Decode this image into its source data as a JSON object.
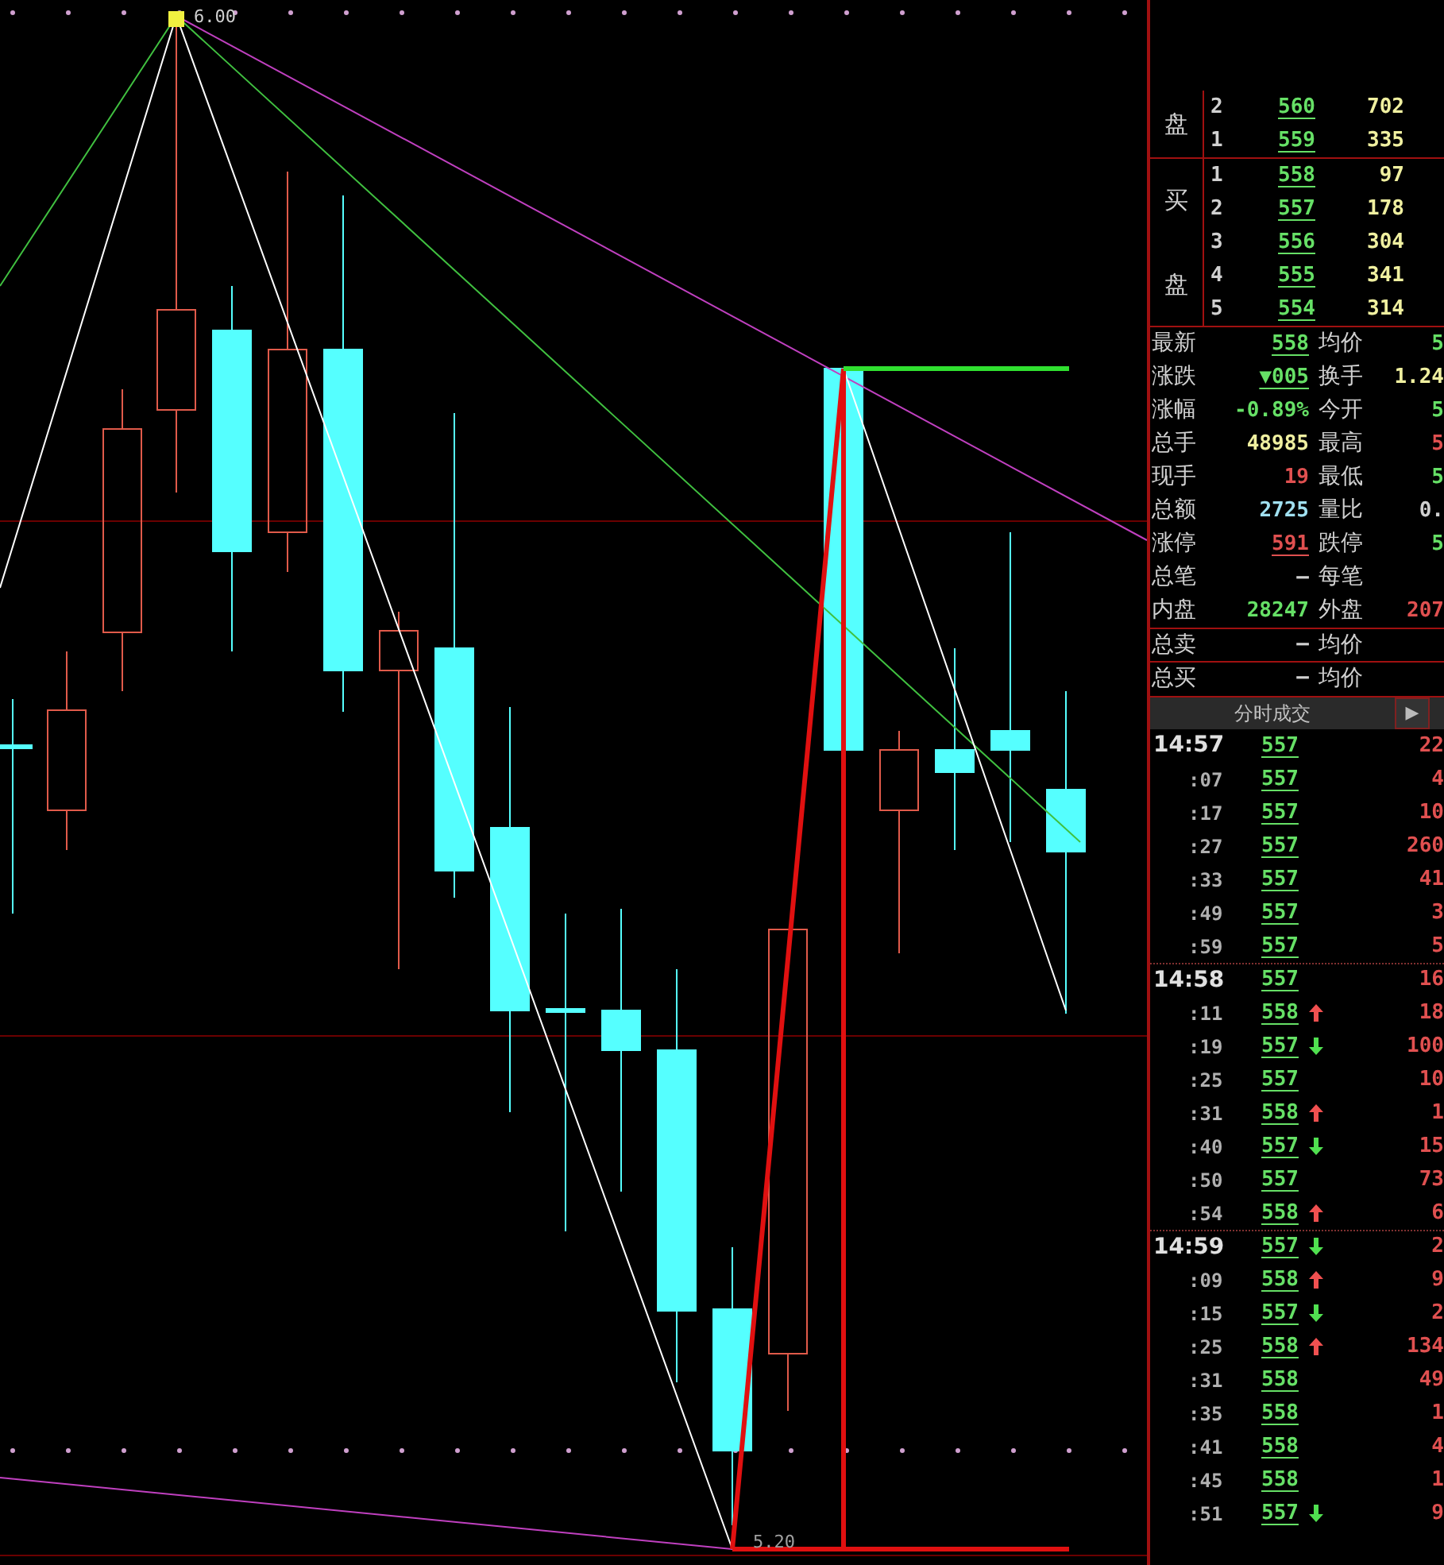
{
  "chart": {
    "high_label": "6.00",
    "low_label": "5.20"
  },
  "order_book": {
    "sell": {
      "labels": [
        "盘"
      ],
      "levels": [
        {
          "level": "2",
          "price": "560",
          "volume": "702"
        },
        {
          "level": "1",
          "price": "559",
          "volume": "335"
        }
      ]
    },
    "buy": {
      "labels": [
        "买",
        "盘"
      ],
      "levels": [
        {
          "level": "1",
          "price": "558",
          "volume": "97"
        },
        {
          "level": "2",
          "price": "557",
          "volume": "178"
        },
        {
          "level": "3",
          "price": "556",
          "volume": "304"
        },
        {
          "level": "4",
          "price": "555",
          "volume": "341"
        },
        {
          "level": "5",
          "price": "554",
          "volume": "314"
        }
      ]
    }
  },
  "stats": [
    {
      "cells": [
        {
          "label": "最新",
          "value": "558",
          "color": "#66e066",
          "underlined": true
        },
        {
          "label": "均价",
          "value": "5",
          "color": "#66e066",
          "underlined": false
        }
      ]
    },
    {
      "cells": [
        {
          "label": "涨跌",
          "value": "▼005",
          "color": "#66e066",
          "underlined": true
        },
        {
          "label": "换手",
          "value": "1.24",
          "color": "#f0f0a0",
          "underlined": false
        }
      ]
    },
    {
      "cells": [
        {
          "label": "涨幅",
          "value": "-0.89%",
          "color": "#66e066",
          "underlined": false
        },
        {
          "label": "今开",
          "value": "5",
          "color": "#66e066",
          "underlined": false
        }
      ]
    },
    {
      "cells": [
        {
          "label": "总手",
          "value": "48985",
          "color": "#f0f0a0",
          "underlined": false
        },
        {
          "label": "最高",
          "value": "5",
          "color": "#e05050",
          "underlined": false
        }
      ]
    },
    {
      "cells": [
        {
          "label": "现手",
          "value": "19",
          "color": "#e05050",
          "underlined": false
        },
        {
          "label": "最低",
          "value": "5",
          "color": "#66e066",
          "underlined": false
        }
      ]
    },
    {
      "cells": [
        {
          "label": "总额",
          "value": "2725",
          "color": "#a0e0f0",
          "underlined": false
        },
        {
          "label": "量比",
          "value": "0.",
          "color": "#d0d0d0",
          "underlined": false
        }
      ]
    },
    {
      "cells": [
        {
          "label": "涨停",
          "value": "591",
          "color": "#e05050",
          "underlined": true
        },
        {
          "label": "跌停",
          "value": "5",
          "color": "#66e066",
          "underlined": false
        }
      ]
    },
    {
      "cells": [
        {
          "label": "总笔",
          "value": "–",
          "color": "#d0d0d0",
          "underlined": false
        },
        {
          "label": "每笔"
        }
      ]
    },
    {
      "cells": [
        {
          "label": "内盘",
          "value": "28247",
          "color": "#66e066",
          "underlined": false
        },
        {
          "label": "外盘",
          "value": "207",
          "color": "#e05050",
          "underlined": false
        }
      ]
    }
  ],
  "totals": [
    {
      "label": "总卖",
      "value": "–",
      "label_2": "均价"
    },
    {
      "label": "总买",
      "value": "–",
      "label_2": "均价"
    }
  ],
  "ticks_header": {
    "title": "分时成交",
    "button": "▶"
  },
  "ticks": [
    {
      "kind": "minute",
      "time": "14:57",
      "price": "557",
      "rising": false,
      "falling": false,
      "volume": "22"
    },
    {
      "kind": "second",
      "time": ":07",
      "price": "557",
      "rising": false,
      "falling": false,
      "volume": "4"
    },
    {
      "kind": "second",
      "time": ":17",
      "price": "557",
      "rising": false,
      "falling": false,
      "volume": "10"
    },
    {
      "kind": "second",
      "time": ":27",
      "price": "557",
      "rising": false,
      "falling": false,
      "volume": "260"
    },
    {
      "kind": "second",
      "time": ":33",
      "price": "557",
      "rising": false,
      "falling": false,
      "volume": "41"
    },
    {
      "kind": "second",
      "time": ":49",
      "price": "557",
      "rising": false,
      "falling": false,
      "volume": "3"
    },
    {
      "kind": "second",
      "time": ":59",
      "price": "557",
      "rising": false,
      "falling": false,
      "volume": "5"
    },
    {
      "kind": "minute",
      "time": "14:58",
      "price": "557",
      "rising": false,
      "falling": false,
      "volume": "16"
    },
    {
      "kind": "second",
      "time": ":11",
      "price": "558",
      "rising": true,
      "falling": false,
      "volume": "18"
    },
    {
      "kind": "second",
      "time": ":19",
      "price": "557",
      "rising": false,
      "falling": true,
      "volume": "100"
    },
    {
      "kind": "second",
      "time": ":25",
      "price": "557",
      "rising": false,
      "falling": false,
      "volume": "10"
    },
    {
      "kind": "second",
      "time": ":31",
      "price": "558",
      "rising": true,
      "falling": false,
      "volume": "1"
    },
    {
      "kind": "second",
      "time": ":40",
      "price": "557",
      "rising": false,
      "falling": true,
      "volume": "15"
    },
    {
      "kind": "second",
      "time": ":50",
      "price": "557",
      "rising": false,
      "falling": false,
      "volume": "73"
    },
    {
      "kind": "second",
      "time": ":54",
      "price": "558",
      "rising": true,
      "falling": false,
      "volume": "6"
    },
    {
      "kind": "minute",
      "time": "14:59",
      "price": "557",
      "rising": false,
      "falling": true,
      "volume": "2"
    },
    {
      "kind": "second",
      "time": ":09",
      "price": "558",
      "rising": true,
      "falling": false,
      "volume": "9"
    },
    {
      "kind": "second",
      "time": ":15",
      "price": "557",
      "rising": false,
      "falling": true,
      "volume": "2"
    },
    {
      "kind": "second",
      "time": ":25",
      "price": "558",
      "rising": true,
      "falling": false,
      "volume": "134"
    },
    {
      "kind": "second",
      "time": ":31",
      "price": "558",
      "rising": false,
      "falling": false,
      "volume": "49"
    },
    {
      "kind": "second",
      "time": ":35",
      "price": "558",
      "rising": false,
      "falling": false,
      "volume": "1"
    },
    {
      "kind": "second",
      "time": ":41",
      "price": "558",
      "rising": false,
      "falling": false,
      "volume": "4"
    },
    {
      "kind": "second",
      "time": ":45",
      "price": "558",
      "rising": false,
      "falling": false,
      "volume": "1"
    },
    {
      "kind": "second",
      "time": ":51",
      "price": "557",
      "rising": false,
      "falling": true,
      "volume": "9"
    }
  ]
}
